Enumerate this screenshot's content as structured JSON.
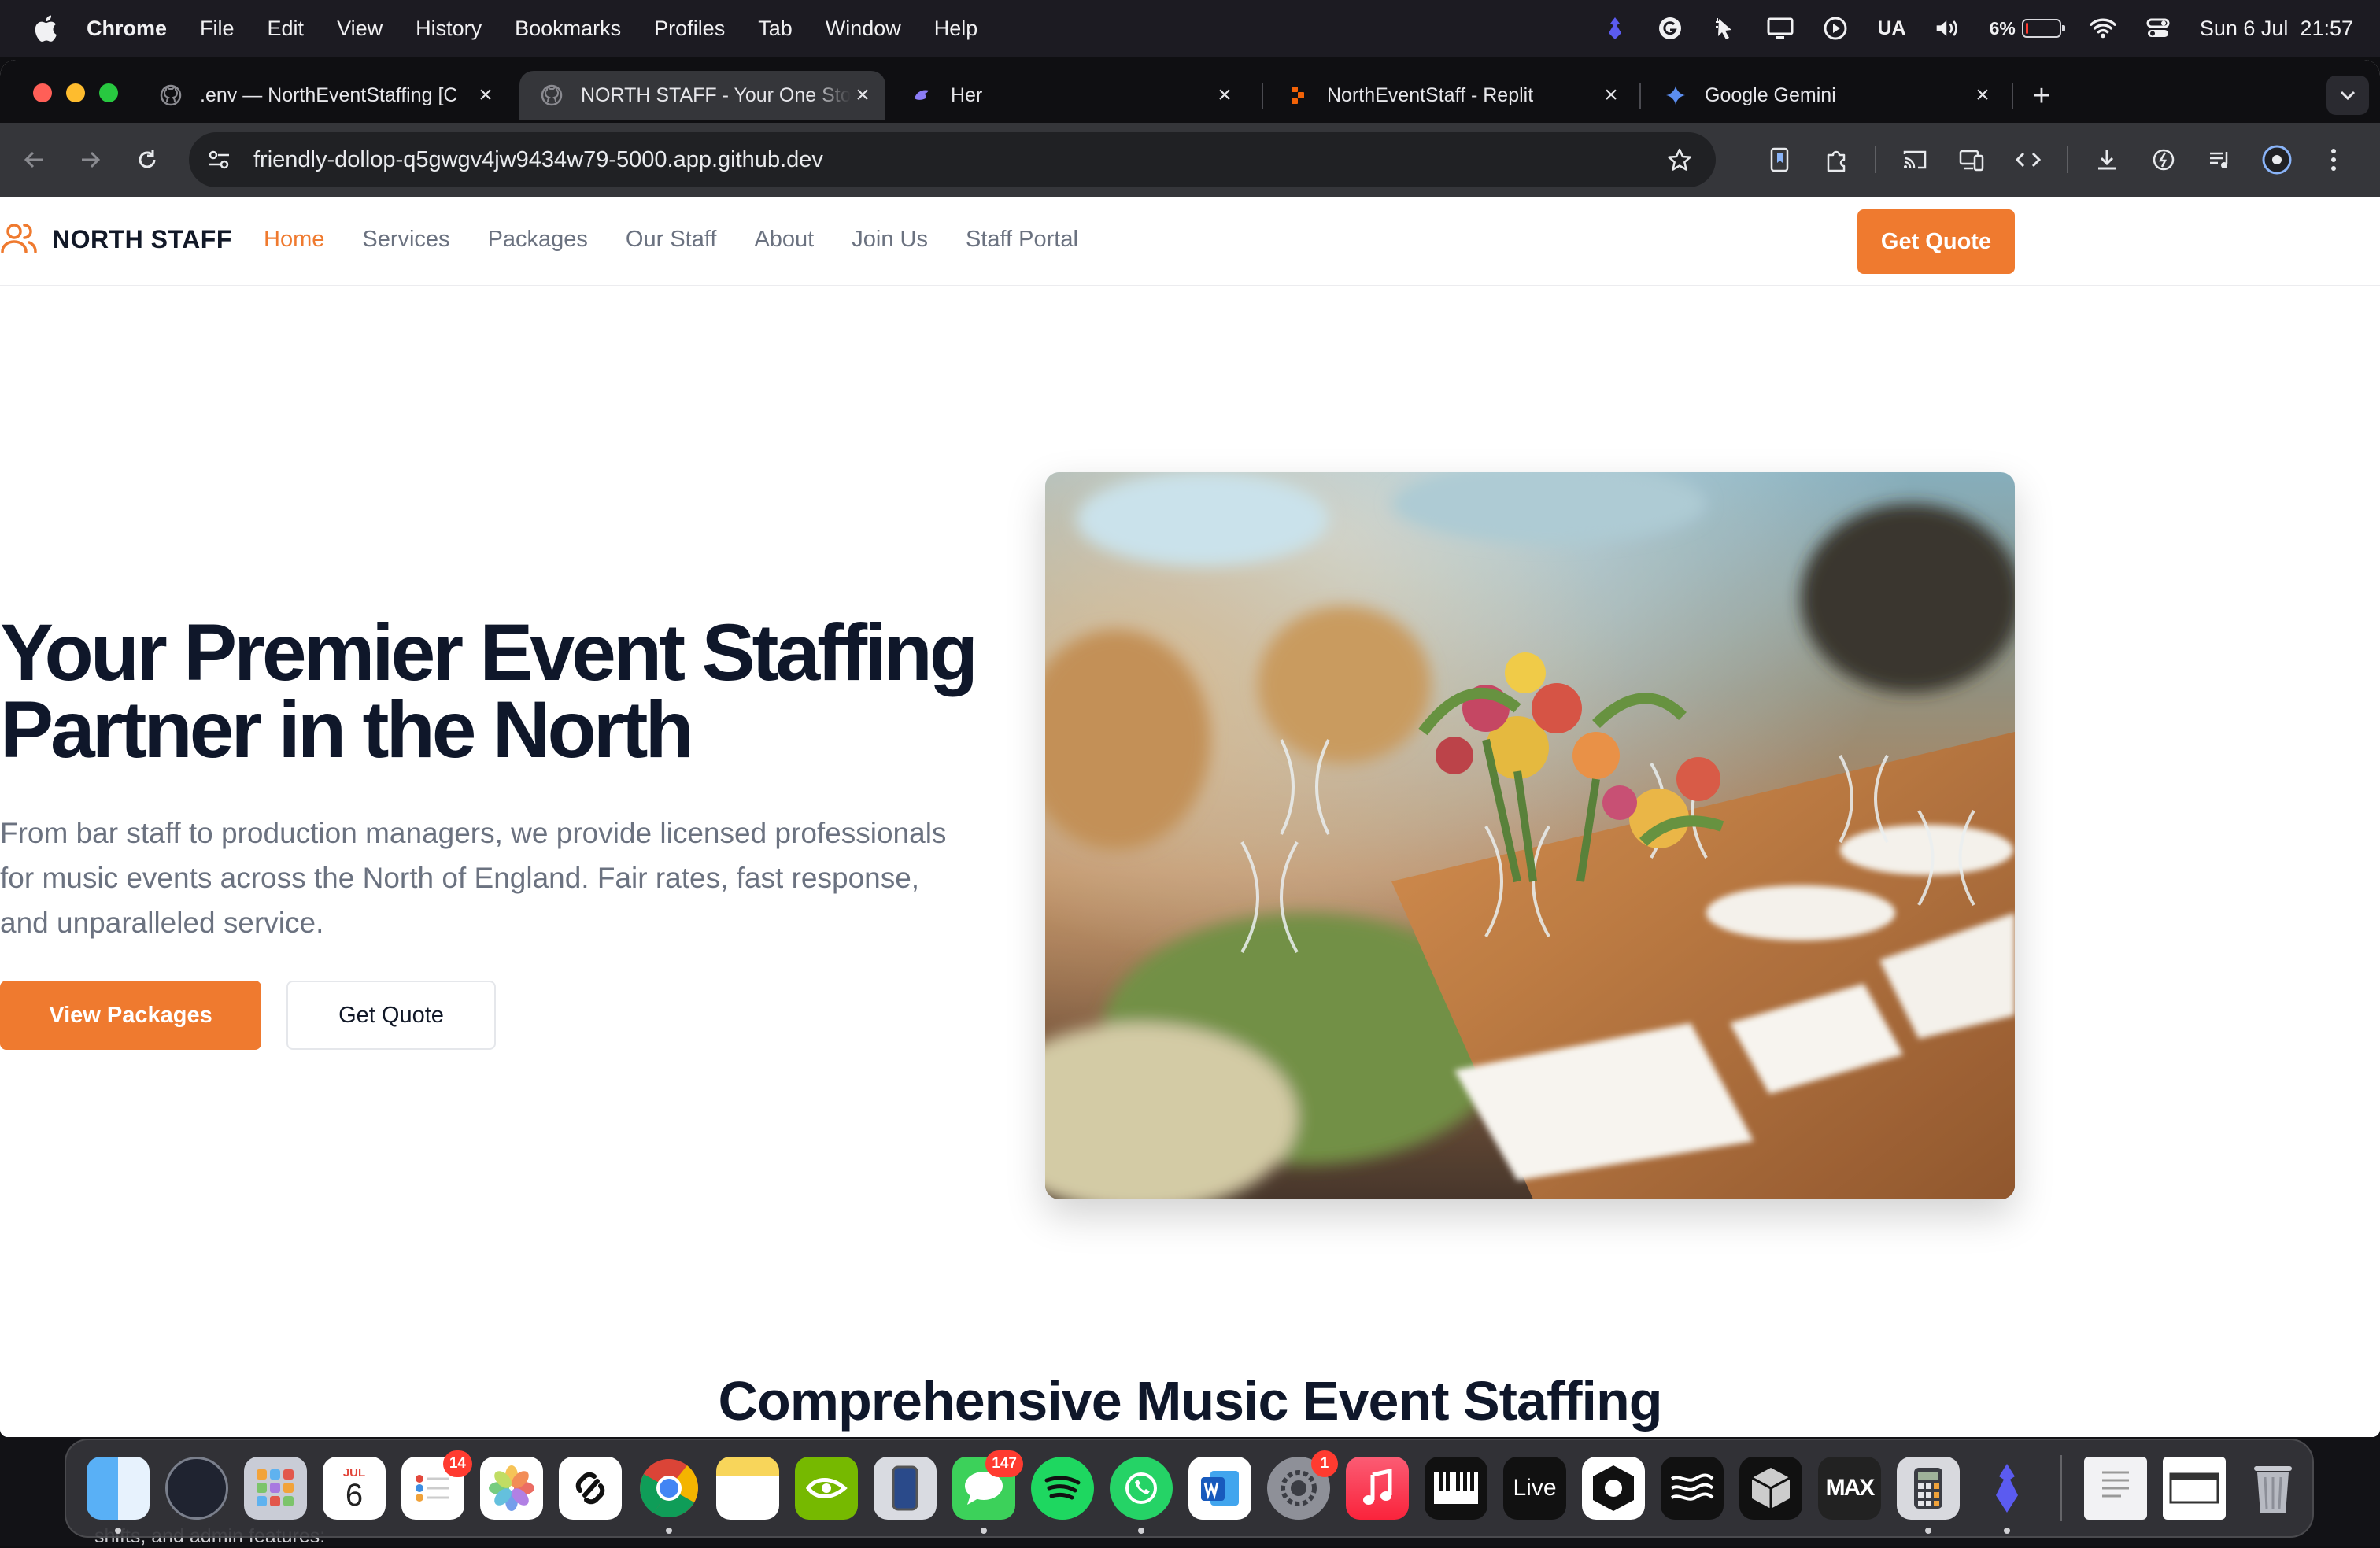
{
  "menubar": {
    "app_name": "Chrome",
    "items": [
      "File",
      "Edit",
      "View",
      "History",
      "Bookmarks",
      "Profiles",
      "Tab",
      "Window",
      "Help"
    ],
    "input_source": "UA",
    "battery_percent": "6%",
    "battery_level": 0.06,
    "clock": "Sun 6 Jul  21:57"
  },
  "browser": {
    "tabs": [
      {
        "title": ".env — NorthEventStaffing [C",
        "icon": "github-icon",
        "active": false
      },
      {
        "title": "NORTH STAFF - Your One Sto",
        "icon": "github-icon",
        "active": true
      },
      {
        "title": "Her",
        "icon": "her-app-icon",
        "active": false
      },
      {
        "title": "NorthEventStaff - Replit",
        "icon": "replit-icon",
        "active": false
      },
      {
        "title": "Google Gemini",
        "icon": "gemini-icon",
        "active": false
      }
    ],
    "url": "friendly-dollop-q5gwgv4jw9434w79-5000.app.github.dev"
  },
  "site": {
    "brand": "NORTH STAFF",
    "nav": [
      "Home",
      "Services",
      "Packages",
      "Our Staff",
      "About",
      "Join Us",
      "Staff Portal"
    ],
    "active_nav": "Home",
    "nav_cta": "Get Quote",
    "hero": {
      "title": "Your Premier Event Staffing Partner in the North",
      "subtitle": "From bar staff to production managers, we provide licensed professionals for music events across the North of England. Fair rates, fast response, and unparalleled service.",
      "primary_button": "View Packages",
      "secondary_button": "Get Quote"
    },
    "next_section_heading": "Comprehensive Music Event Staffing",
    "accent_color": "#ef7a2f"
  },
  "behind_window_text": "shifts, and admin features:",
  "dock": {
    "calendar_month": "JUL",
    "calendar_day": "6",
    "reminders_badge": "14",
    "messages_badge": "147",
    "settings_badge": "1",
    "live_label": "Live",
    "max_label": "MAX"
  }
}
